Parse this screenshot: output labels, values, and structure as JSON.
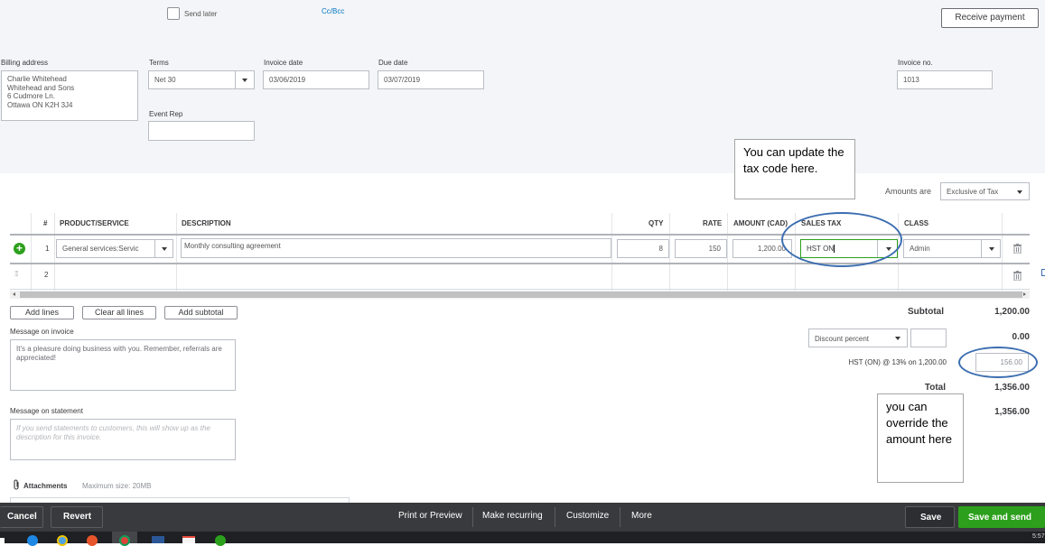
{
  "header": {
    "send_later_label": "Send later",
    "cc_bcc_label": "Cc/Bcc",
    "receive_payment_label": "Receive payment"
  },
  "form": {
    "billing_address_label": "Billing address",
    "billing_address_lines": [
      "Charlie Whitehead",
      "Whitehead and Sons",
      "6 Cudmore Ln.",
      "Ottawa ON  K2H 3J4"
    ],
    "terms_label": "Terms",
    "terms_value": "Net 30",
    "invoice_date_label": "Invoice date",
    "invoice_date_value": "03/06/2019",
    "due_date_label": "Due date",
    "due_date_value": "03/07/2019",
    "event_rep_label": "Event Rep",
    "event_rep_value": "",
    "invoice_no_label": "Invoice no.",
    "invoice_no_value": "1013"
  },
  "amounts_are": {
    "label": "Amounts are",
    "value": "Exclusive of Tax"
  },
  "table": {
    "columns": [
      "#",
      "PRODUCT/SERVICE",
      "DESCRIPTION",
      "QTY",
      "RATE",
      "AMOUNT (CAD)",
      "SALES TAX",
      "CLASS"
    ],
    "rows": [
      {
        "num": "1",
        "product": "General services:Servic",
        "description": "Monthly consulting agreement",
        "qty": "8",
        "rate": "150",
        "amount": "1,200.00",
        "sales_tax": "HST ON",
        "class": "Admin"
      },
      {
        "num": "2",
        "product": "",
        "description": "",
        "qty": "",
        "rate": "",
        "amount": "",
        "sales_tax": "",
        "class": ""
      }
    ]
  },
  "line_actions": {
    "add_lines": "Add lines",
    "clear_all_lines": "Clear all lines",
    "add_subtotal": "Add subtotal"
  },
  "messages": {
    "invoice_label": "Message on invoice",
    "invoice_value": "It's a pleasure doing business with you.  Remember, referrals are appreciated!",
    "statement_label": "Message on statement",
    "statement_placeholder": "If you send statements to customers, this will show up as the description for this invoice."
  },
  "attachments": {
    "label": "Attachments",
    "max_size": "Maximum size: 20MB"
  },
  "totals": {
    "subtotal_label": "Subtotal",
    "subtotal_value": "1,200.00",
    "discount_type": "Discount percent",
    "discount_input": "",
    "discount_value": "0.00",
    "tax_label": "HST (ON) @ 13% on 1,200.00",
    "tax_value": "156.00",
    "total_label": "Total",
    "total_value": "1,356.00",
    "balance_value": "1,356.00"
  },
  "annotations": {
    "tax_code_note": "You can update the tax code here.",
    "override_note": "you can override the amount here"
  },
  "footer": {
    "cancel": "Cancel",
    "revert": "Revert",
    "print_preview": "Print or Preview",
    "make_recurring": "Make recurring",
    "customize": "Customize",
    "more": "More",
    "save": "Save",
    "save_and_send": "Save and send"
  },
  "taskbar": {
    "clock": "5:57"
  },
  "colors": {
    "accent_green": "#2ca01c",
    "annotation_blue": "#3c6eb0",
    "link_blue": "#0077c5",
    "footer_bg": "#393a3d"
  }
}
